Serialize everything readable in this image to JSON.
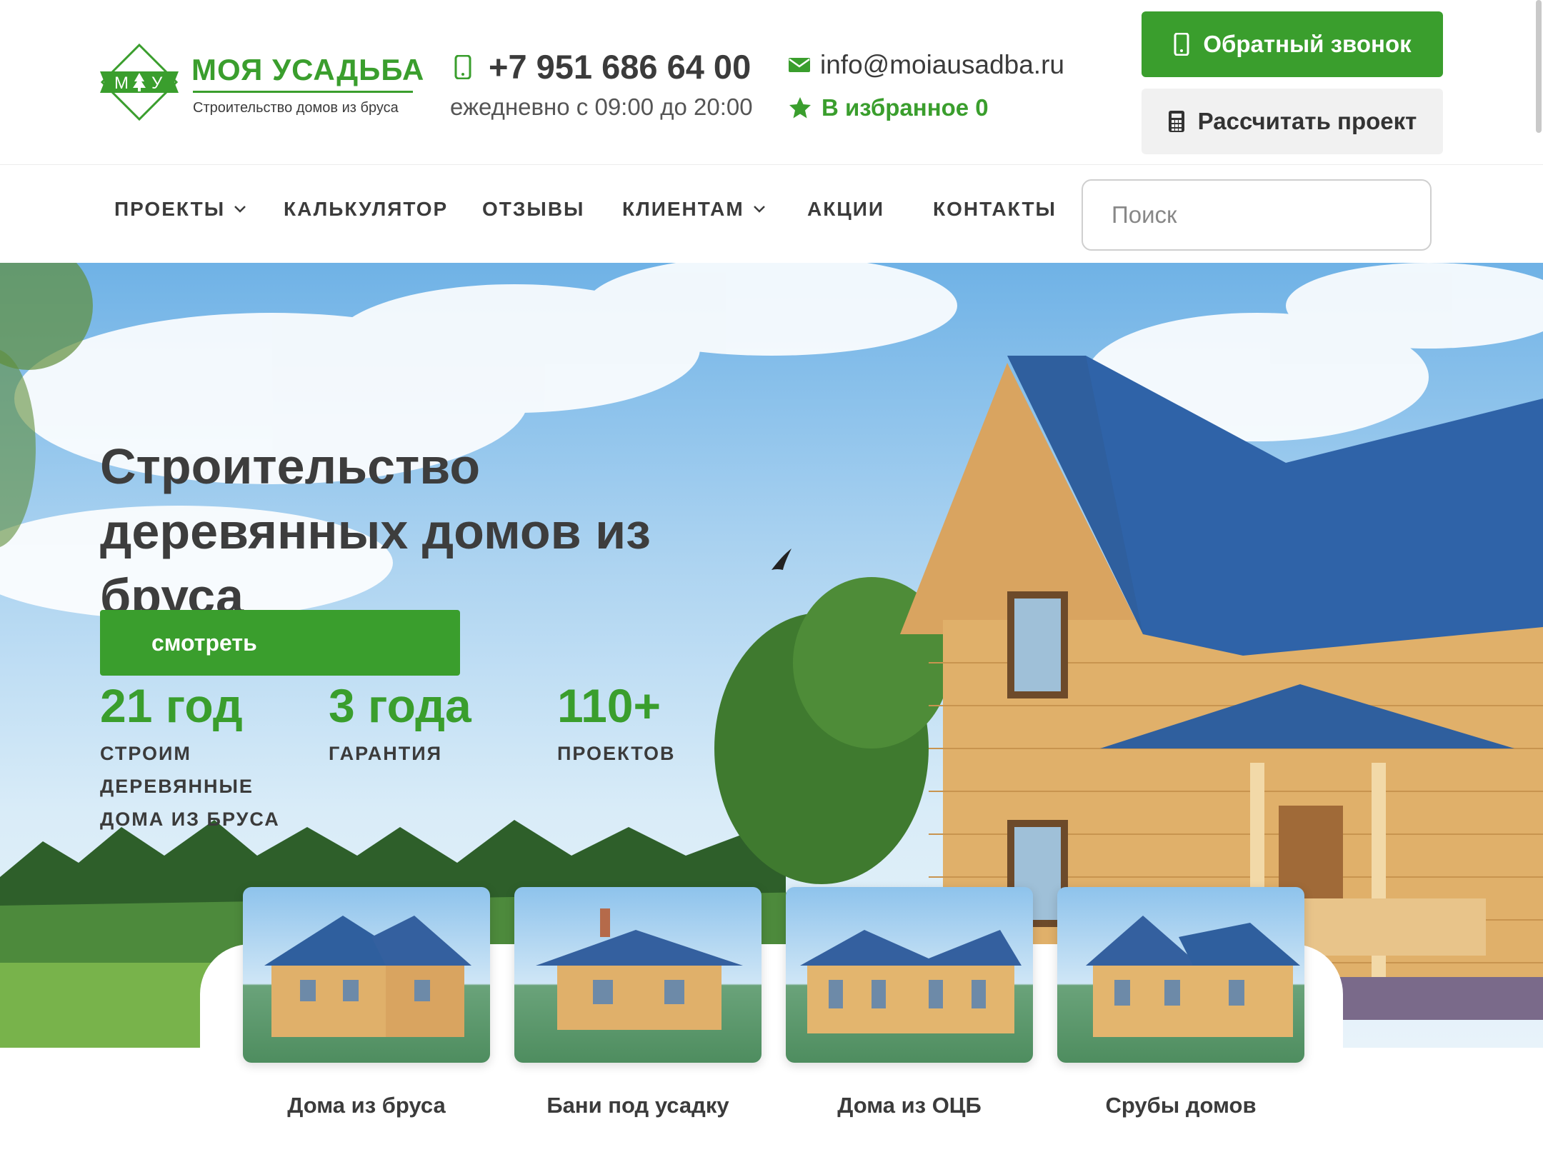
{
  "header": {
    "logo_title": "МОЯ УСАДЬБА",
    "logo_subtitle": "Строительство домов из бруса",
    "logo_mark_left": "М",
    "logo_mark_right": "У",
    "phone": "+7 951 686 64 00",
    "hours": "ежедневно с 09:00 до 20:00",
    "email": "info@moiausadba.ru",
    "favorites": "В избранное 0",
    "callback_label": "Обратный звонок",
    "calc_label": "Рассчитать проект"
  },
  "nav": {
    "items": [
      {
        "label": "ПРОЕКТЫ",
        "has_dropdown": true
      },
      {
        "label": "КАЛЬКУЛЯТОР",
        "has_dropdown": false
      },
      {
        "label": "ОТЗЫВЫ",
        "has_dropdown": false
      },
      {
        "label": "КЛИЕНТАМ",
        "has_dropdown": true
      },
      {
        "label": "АКЦИИ",
        "has_dropdown": false
      },
      {
        "label": "КОНТАКТЫ",
        "has_dropdown": false
      }
    ],
    "search_placeholder": "Поиск"
  },
  "hero": {
    "title": "Строительство деревянных домов из бруса",
    "stats": [
      {
        "value": "21 год",
        "label": "СТРОИМ ДЕРЕВЯННЫЕ ДОМА ИЗ БРУСА"
      },
      {
        "value": "3 года",
        "label": "ГАРАНТИЯ"
      },
      {
        "value": "110+",
        "label": "ПРОЕКТОВ"
      }
    ],
    "view_button": "смотреть"
  },
  "categories": [
    {
      "label": "Дома из бруса"
    },
    {
      "label": "Бани под усадку"
    },
    {
      "label": "Дома из ОЦБ"
    },
    {
      "label": "Срубы домов"
    }
  ],
  "colors": {
    "accent": "#3a9e2d",
    "text": "#3b3b3b",
    "roof": "#2f5f9e",
    "wood": "#e0b06a"
  }
}
